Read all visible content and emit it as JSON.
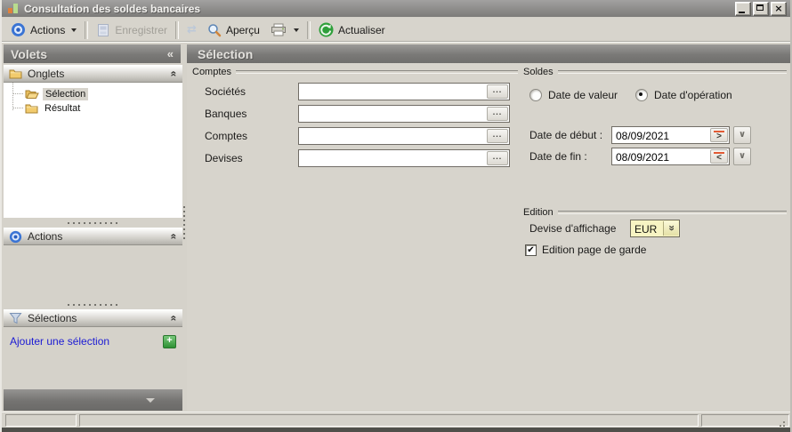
{
  "window": {
    "title": "Consultation des soldes bancaires"
  },
  "glyphs": {
    "collapse_panel": "«",
    "collapse_section": "«",
    "combo_double_chevron": "«",
    "date_next": ">",
    "date_prev": "<",
    "date_dropdown": "∨",
    "browse_ellipsis": "...",
    "checkmark": "✔",
    "close": "×",
    "add_plus": "+",
    "sync_arrows": "⇄"
  },
  "toolbar": {
    "actions": "Actions",
    "enregistrer": "Enregistrer",
    "apercu": "Aperçu",
    "actualiser": "Actualiser"
  },
  "sidebar": {
    "header": "Volets",
    "onglets": {
      "label": "Onglets",
      "items": [
        {
          "label": "Sélection",
          "selected": true
        },
        {
          "label": "Résultat",
          "selected": false
        }
      ]
    },
    "actions_section": {
      "label": "Actions"
    },
    "selections_section": {
      "label": "Sélections",
      "add_link": "Ajouter une sélection"
    }
  },
  "main": {
    "header": "Sélection",
    "comptes": {
      "label": "Comptes",
      "fields": [
        {
          "label": "Sociétés",
          "value": ""
        },
        {
          "label": "Banques",
          "value": ""
        },
        {
          "label": "Comptes",
          "value": ""
        },
        {
          "label": "Devises",
          "value": ""
        }
      ]
    },
    "soldes": {
      "label": "Soldes",
      "radio_valeur": {
        "label": "Date de valeur",
        "selected": false
      },
      "radio_operation": {
        "label": "Date d'opération",
        "selected": true
      },
      "date_debut": {
        "label": "Date de début :",
        "value": "08/09/2021"
      },
      "date_fin": {
        "label": "Date de fin :",
        "value": "08/09/2021"
      }
    },
    "edition": {
      "label": "Edition",
      "devise": {
        "label": "Devise d'affichage",
        "value": "EUR"
      },
      "page_garde": {
        "label": "Edition page de garde",
        "checked": true
      }
    }
  },
  "colors": {
    "accent_orange": "#e25b35",
    "folder_yellow": "#f2cb6d",
    "link_blue": "#1b1ad4",
    "combo_yellow": "#f7f4c3",
    "refresh_green": "#2e9f3a",
    "icon_blue": "#3a74d4",
    "header_gray": "#7a7977"
  }
}
